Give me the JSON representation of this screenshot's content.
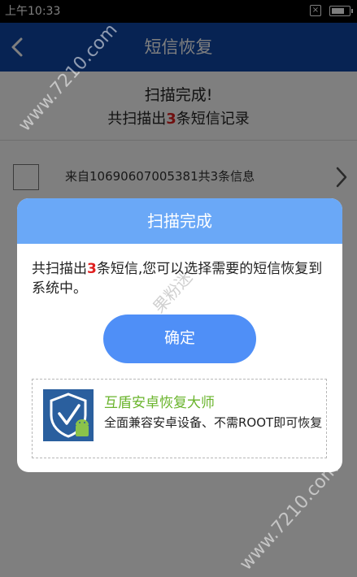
{
  "status_bar": {
    "time": "上午10:33",
    "battery_level": 0.8
  },
  "app_bar": {
    "title": "短信恢复",
    "back_icon": "back-arrow-icon"
  },
  "scan": {
    "done_text": "扫描完成!",
    "summary_prefix": "共扫描出",
    "summary_count": "3",
    "summary_suffix": "条短信记录"
  },
  "sms_list": [
    {
      "label": "来自10690607005381共3条信息"
    }
  ],
  "dialog": {
    "title": "扫描完成",
    "body_prefix": "共扫描出",
    "body_count": "3",
    "body_suffix": "条短信,您可以选择需要的短信恢复到系统中。",
    "confirm_label": "确定",
    "promo": {
      "title": "互盾安卓恢复大师",
      "description": "全面兼容安卓设备、不需ROOT即可恢复"
    }
  },
  "watermarks": [
    "www.7210.com",
    "果粉迷",
    "www.7210.com"
  ],
  "colors": {
    "app_bar": "#0f46a6",
    "dialog_header": "#6aa8f7",
    "confirm_button": "#4f8ff7",
    "highlight": "#e02020",
    "promo_title": "#6ab42c"
  }
}
